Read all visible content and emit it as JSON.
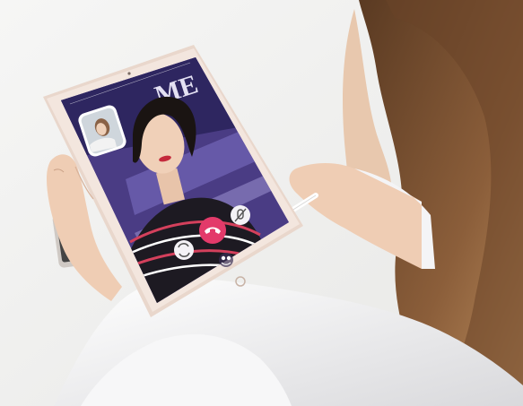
{
  "scene": {
    "backdrop_sign_text": "ME",
    "colors": {
      "background": "#f1f1f0",
      "tablet_frame": "#e9d7cc",
      "call_end_button": "#e33a6a",
      "tablet_screen_bg": "#5b4a86"
    }
  },
  "video_call": {
    "self_view_icon": "person-thumbnail-icon",
    "end_call_icon": "phone-hangup-icon",
    "switch_camera_icon": "camera-rotate-icon",
    "effects_icon": "effects-icon",
    "mute_icon": "mic-off-icon"
  }
}
